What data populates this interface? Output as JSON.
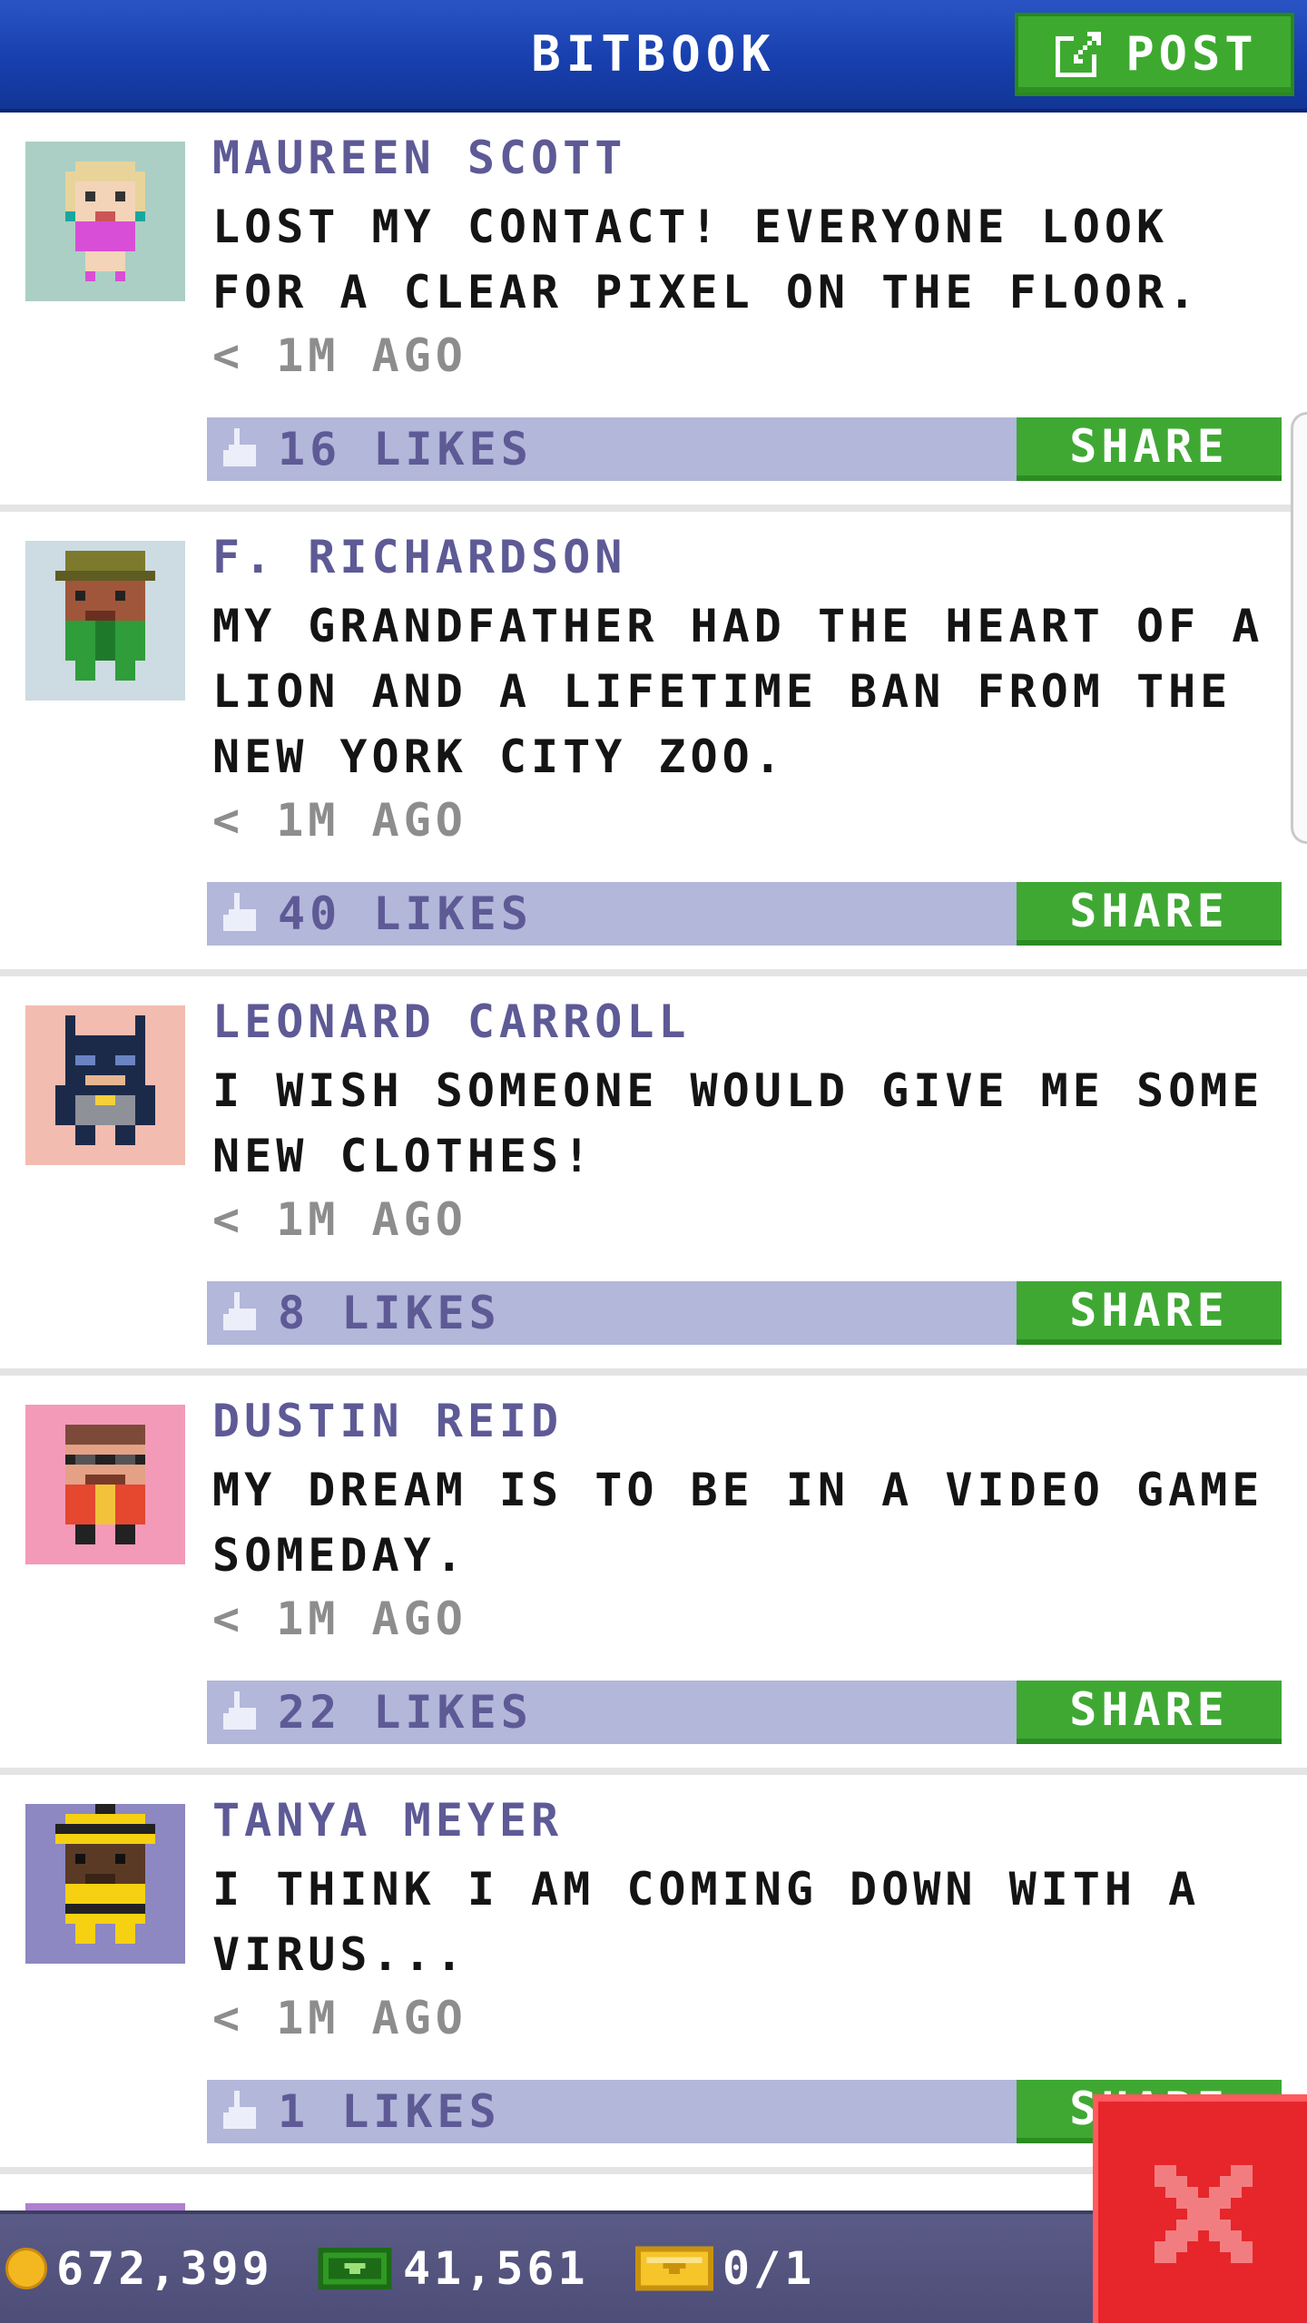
{
  "header": {
    "title": "BITBOOK",
    "post_label": "POST",
    "post_icon": "edit-icon"
  },
  "posts": [
    {
      "author": "MAUREEN SCOTT",
      "message": "LOST MY CONTACT! EVERYONE LOOK\nFOR A CLEAR PIXEL ON THE FLOOR.",
      "time": "< 1M AGO",
      "likes": "16 LIKES",
      "share": "SHARE",
      "avatar_bg": "#abcfc4"
    },
    {
      "author": "F. RICHARDSON",
      "message": "MY GRANDFATHER HAD THE HEART OF A\nLION AND A LIFETIME BAN FROM THE\nNEW YORK CITY ZOO.",
      "time": "< 1M AGO",
      "likes": "40 LIKES",
      "share": "SHARE",
      "avatar_bg": "#cddbe2"
    },
    {
      "author": "LEONARD CARROLL",
      "message": "I WISH SOMEONE WOULD GIVE ME SOME\nNEW CLOTHES!",
      "time": "< 1M AGO",
      "likes": "8 LIKES",
      "share": "SHARE",
      "avatar_bg": "#f3bcb0"
    },
    {
      "author": "DUSTIN REID",
      "message": "MY DREAM IS TO BE IN A VIDEO GAME\nSOMEDAY.",
      "time": "< 1M AGO",
      "likes": "22 LIKES",
      "share": "SHARE",
      "avatar_bg": "#f49ab9"
    },
    {
      "author": "TANYA MEYER",
      "message": "I THINK I AM COMING DOWN WITH A\nVIRUS...",
      "time": "< 1M AGO",
      "likes": "1 LIKES",
      "share": "SHARE",
      "avatar_bg": "#8d87c2"
    }
  ],
  "resources": {
    "coins": "672,399",
    "bux": "41,561",
    "tickets": "0/1"
  },
  "colors": {
    "header_blue": "#1a43b3",
    "button_green": "#3fa833",
    "likes_bar": "#b3b7d9",
    "name_purple": "#5d5a96",
    "close_red": "#e6262b"
  }
}
